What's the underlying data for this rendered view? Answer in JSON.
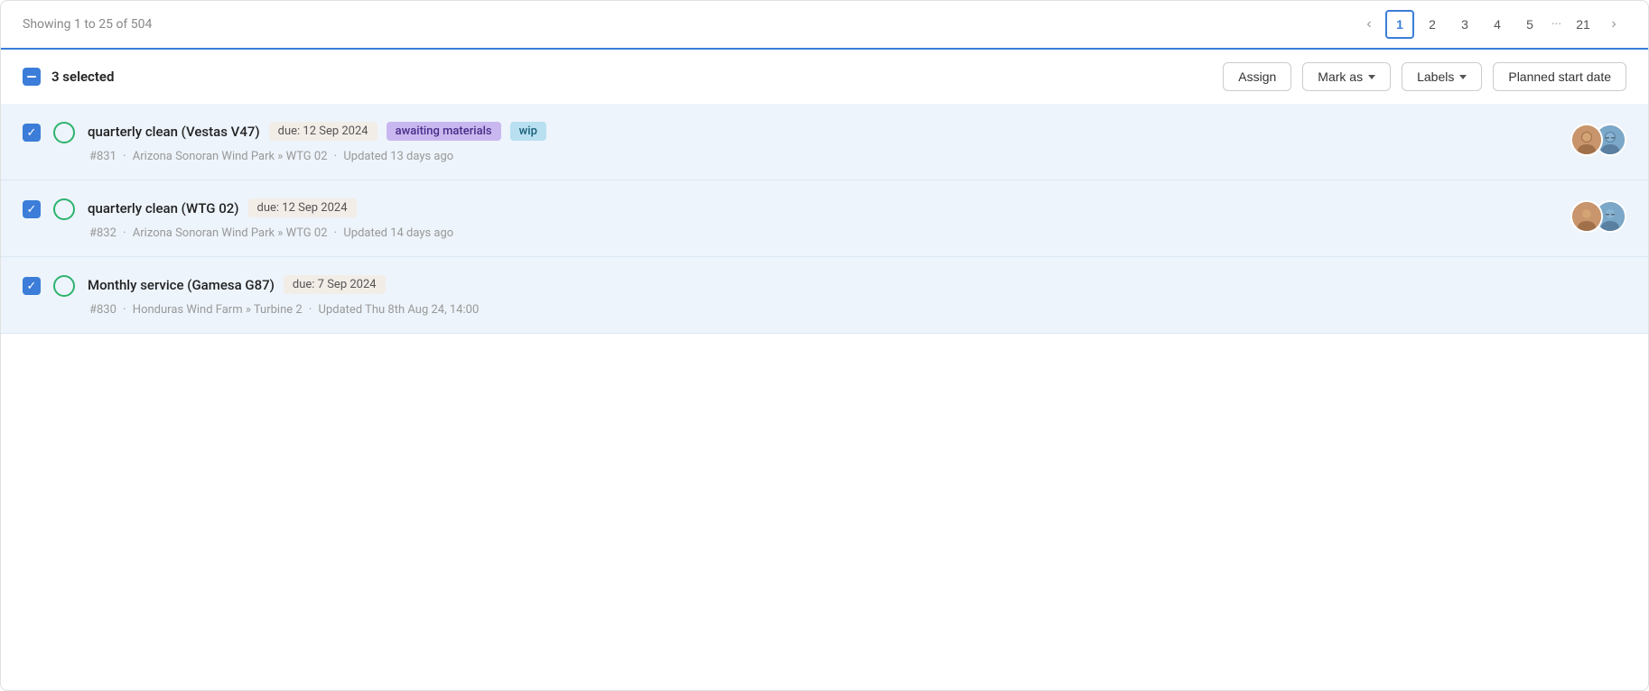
{
  "pagination": {
    "showing_label": "Showing 1 to 25 of 504",
    "prev_icon": "‹",
    "next_icon": "›",
    "pages": [
      "1",
      "2",
      "3",
      "4",
      "5",
      "...",
      "21"
    ],
    "active_page": "1"
  },
  "toolbar": {
    "selected_count": "3 selected",
    "assign_label": "Assign",
    "mark_as_label": "Mark as",
    "labels_label": "Labels",
    "planned_start_label": "Planned start date"
  },
  "work_orders": [
    {
      "id": "item-1",
      "title": "quarterly clean (Vestas V47)",
      "due": "due: 12 Sep 2024",
      "labels": [
        {
          "text": "awaiting materials",
          "type": "awaiting"
        },
        {
          "text": "wip",
          "type": "wip"
        }
      ],
      "meta_number": "#831",
      "meta_location": "Arizona Sonoran Wind Park » WTG 02",
      "meta_updated": "Updated 13 days ago",
      "has_avatars": true,
      "checked": true
    },
    {
      "id": "item-2",
      "title": "quarterly clean (WTG 02)",
      "due": "due: 12 Sep 2024",
      "labels": [],
      "meta_number": "#832",
      "meta_location": "Arizona Sonoran Wind Park » WTG 02",
      "meta_updated": "Updated 14 days ago",
      "has_avatars": true,
      "checked": true
    },
    {
      "id": "item-3",
      "title": "Monthly service (Gamesa G87)",
      "due": "due: 7 Sep 2024",
      "labels": [],
      "meta_number": "#830",
      "meta_location": "Honduras Wind Farm » Turbine 2",
      "meta_updated": "Updated Thu 8th Aug 24, 14:00",
      "has_avatars": false,
      "checked": true
    }
  ]
}
